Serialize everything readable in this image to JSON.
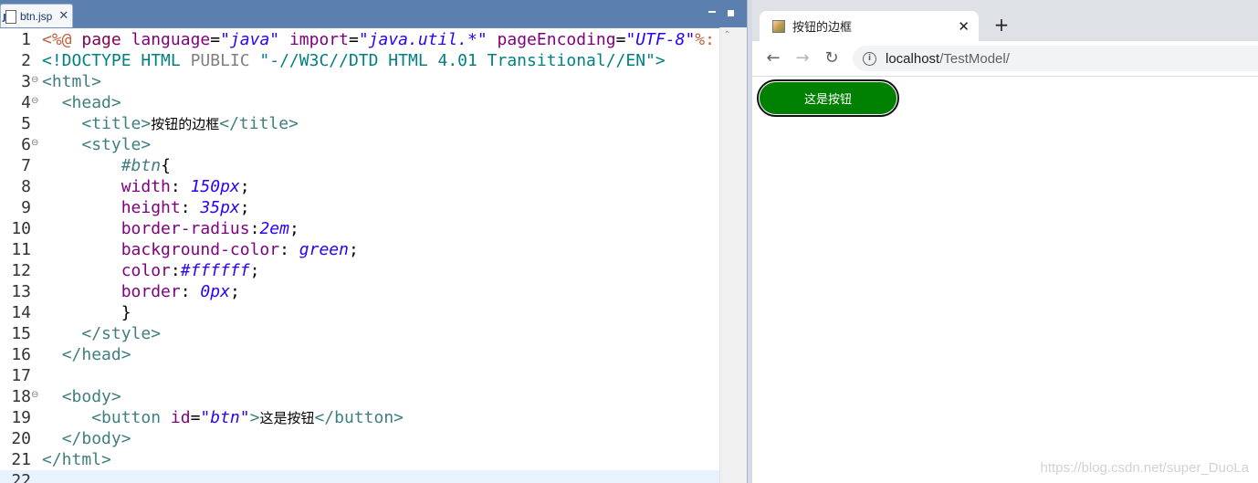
{
  "editor": {
    "tab_label": "btn.jsp",
    "tab_close": "✕",
    "code_lines": [
      {
        "n": "1",
        "fold": false
      },
      {
        "n": "2",
        "fold": false
      },
      {
        "n": "3",
        "fold": true
      },
      {
        "n": "4",
        "fold": true
      },
      {
        "n": "5",
        "fold": false
      },
      {
        "n": "6",
        "fold": true
      },
      {
        "n": "7",
        "fold": false
      },
      {
        "n": "8",
        "fold": false
      },
      {
        "n": "9",
        "fold": false
      },
      {
        "n": "10",
        "fold": false
      },
      {
        "n": "11",
        "fold": false
      },
      {
        "n": "12",
        "fold": false
      },
      {
        "n": "13",
        "fold": false
      },
      {
        "n": "14",
        "fold": false
      },
      {
        "n": "15",
        "fold": false
      },
      {
        "n": "16",
        "fold": false
      },
      {
        "n": "17",
        "fold": false
      },
      {
        "n": "18",
        "fold": true
      },
      {
        "n": "19",
        "fold": false
      },
      {
        "n": "20",
        "fold": false
      },
      {
        "n": "21",
        "fold": false
      },
      {
        "n": "22",
        "fold": false
      }
    ],
    "tokens": {
      "l1": [
        [
          "dir",
          "<%@ "
        ],
        [
          "kw",
          "page "
        ],
        [
          "attr",
          "language"
        ],
        [
          "plain",
          "="
        ],
        [
          "str",
          "\"java\" "
        ],
        [
          "attr",
          "import"
        ],
        [
          "plain",
          "="
        ],
        [
          "str",
          "\"java.util.*\" "
        ],
        [
          "attr",
          "pageEncoding"
        ],
        [
          "plain",
          "="
        ],
        [
          "str",
          "\"UTF-8\""
        ],
        [
          "dir",
          "%:"
        ]
      ],
      "l2": [
        [
          "doctype",
          "<!DOCTYPE HTML "
        ],
        [
          "doctype-gray",
          "PUBLIC "
        ],
        [
          "doctype",
          "\"-//W3C//DTD HTML 4.01 Transitional//EN\">"
        ]
      ],
      "l3": [
        [
          "tag",
          "<html>"
        ]
      ],
      "l4": [
        [
          "plain",
          "  "
        ],
        [
          "tag",
          "<head>"
        ]
      ],
      "l5": [
        [
          "plain",
          "    "
        ],
        [
          "tag",
          "<title>"
        ],
        [
          "txt",
          "按钮的边框"
        ],
        [
          "tag",
          "</title>"
        ]
      ],
      "l6": [
        [
          "plain",
          "    "
        ],
        [
          "tag",
          "<style>"
        ]
      ],
      "l7": [
        [
          "plain",
          "        "
        ],
        [
          "sel",
          "#btn"
        ],
        [
          "plain",
          "{"
        ]
      ],
      "l8": [
        [
          "plain",
          "        "
        ],
        [
          "cssprop",
          "width"
        ],
        [
          "plain",
          ": "
        ],
        [
          "cssval",
          "150px"
        ],
        [
          "plain",
          ";"
        ]
      ],
      "l9": [
        [
          "plain",
          "        "
        ],
        [
          "cssprop",
          "height"
        ],
        [
          "plain",
          ": "
        ],
        [
          "cssval",
          "35px"
        ],
        [
          "plain",
          ";"
        ]
      ],
      "l10": [
        [
          "plain",
          "        "
        ],
        [
          "cssprop",
          "border-radius"
        ],
        [
          "plain",
          ":"
        ],
        [
          "cssval",
          "2em"
        ],
        [
          "plain",
          ";"
        ]
      ],
      "l11": [
        [
          "plain",
          "        "
        ],
        [
          "cssprop",
          "background-color"
        ],
        [
          "plain",
          ": "
        ],
        [
          "cssval",
          "green"
        ],
        [
          "plain",
          ";"
        ]
      ],
      "l12": [
        [
          "plain",
          "        "
        ],
        [
          "cssprop",
          "color"
        ],
        [
          "plain",
          ":"
        ],
        [
          "cssval",
          "#ffffff"
        ],
        [
          "plain",
          ";"
        ]
      ],
      "l13": [
        [
          "plain",
          "        "
        ],
        [
          "cssprop",
          "border"
        ],
        [
          "plain",
          ": "
        ],
        [
          "cssval",
          "0px"
        ],
        [
          "plain",
          ";"
        ]
      ],
      "l14": [
        [
          "plain",
          "        }"
        ]
      ],
      "l15": [
        [
          "plain",
          "    "
        ],
        [
          "tag",
          "</style>"
        ]
      ],
      "l16": [
        [
          "plain",
          "  "
        ],
        [
          "tag",
          "</head>"
        ]
      ],
      "l17": [],
      "l18": [
        [
          "plain",
          "  "
        ],
        [
          "tag",
          "<body>"
        ]
      ],
      "l19": [
        [
          "plain",
          "     "
        ],
        [
          "tag",
          "<button "
        ],
        [
          "attr",
          "id"
        ],
        [
          "plain",
          "="
        ],
        [
          "str",
          "\"btn\""
        ],
        [
          "tag",
          ">"
        ],
        [
          "txt",
          "这是按钮"
        ],
        [
          "tag",
          "</button>"
        ]
      ],
      "l20": [
        [
          "plain",
          "  "
        ],
        [
          "tag",
          "</body>"
        ]
      ],
      "l21": [
        [
          "tag",
          "</html>"
        ]
      ],
      "l22": []
    }
  },
  "browser": {
    "tab_title": "按钮的边框",
    "tab_close": "✕",
    "new_tab": "+",
    "back": "←",
    "forward": "→",
    "reload": "↻",
    "info": "i",
    "url_host": "localhost",
    "url_path": "/TestModel/",
    "button_label": "这是按钮",
    "watermark": "https://blog.csdn.net/super_DuoLa"
  },
  "colors": {
    "button_bg": "#008000",
    "button_text": "#ffffff",
    "editor_tabbar": "#5b7fae"
  },
  "icons": [
    "jsp-file-icon",
    "favicon-icon",
    "info-icon"
  ]
}
